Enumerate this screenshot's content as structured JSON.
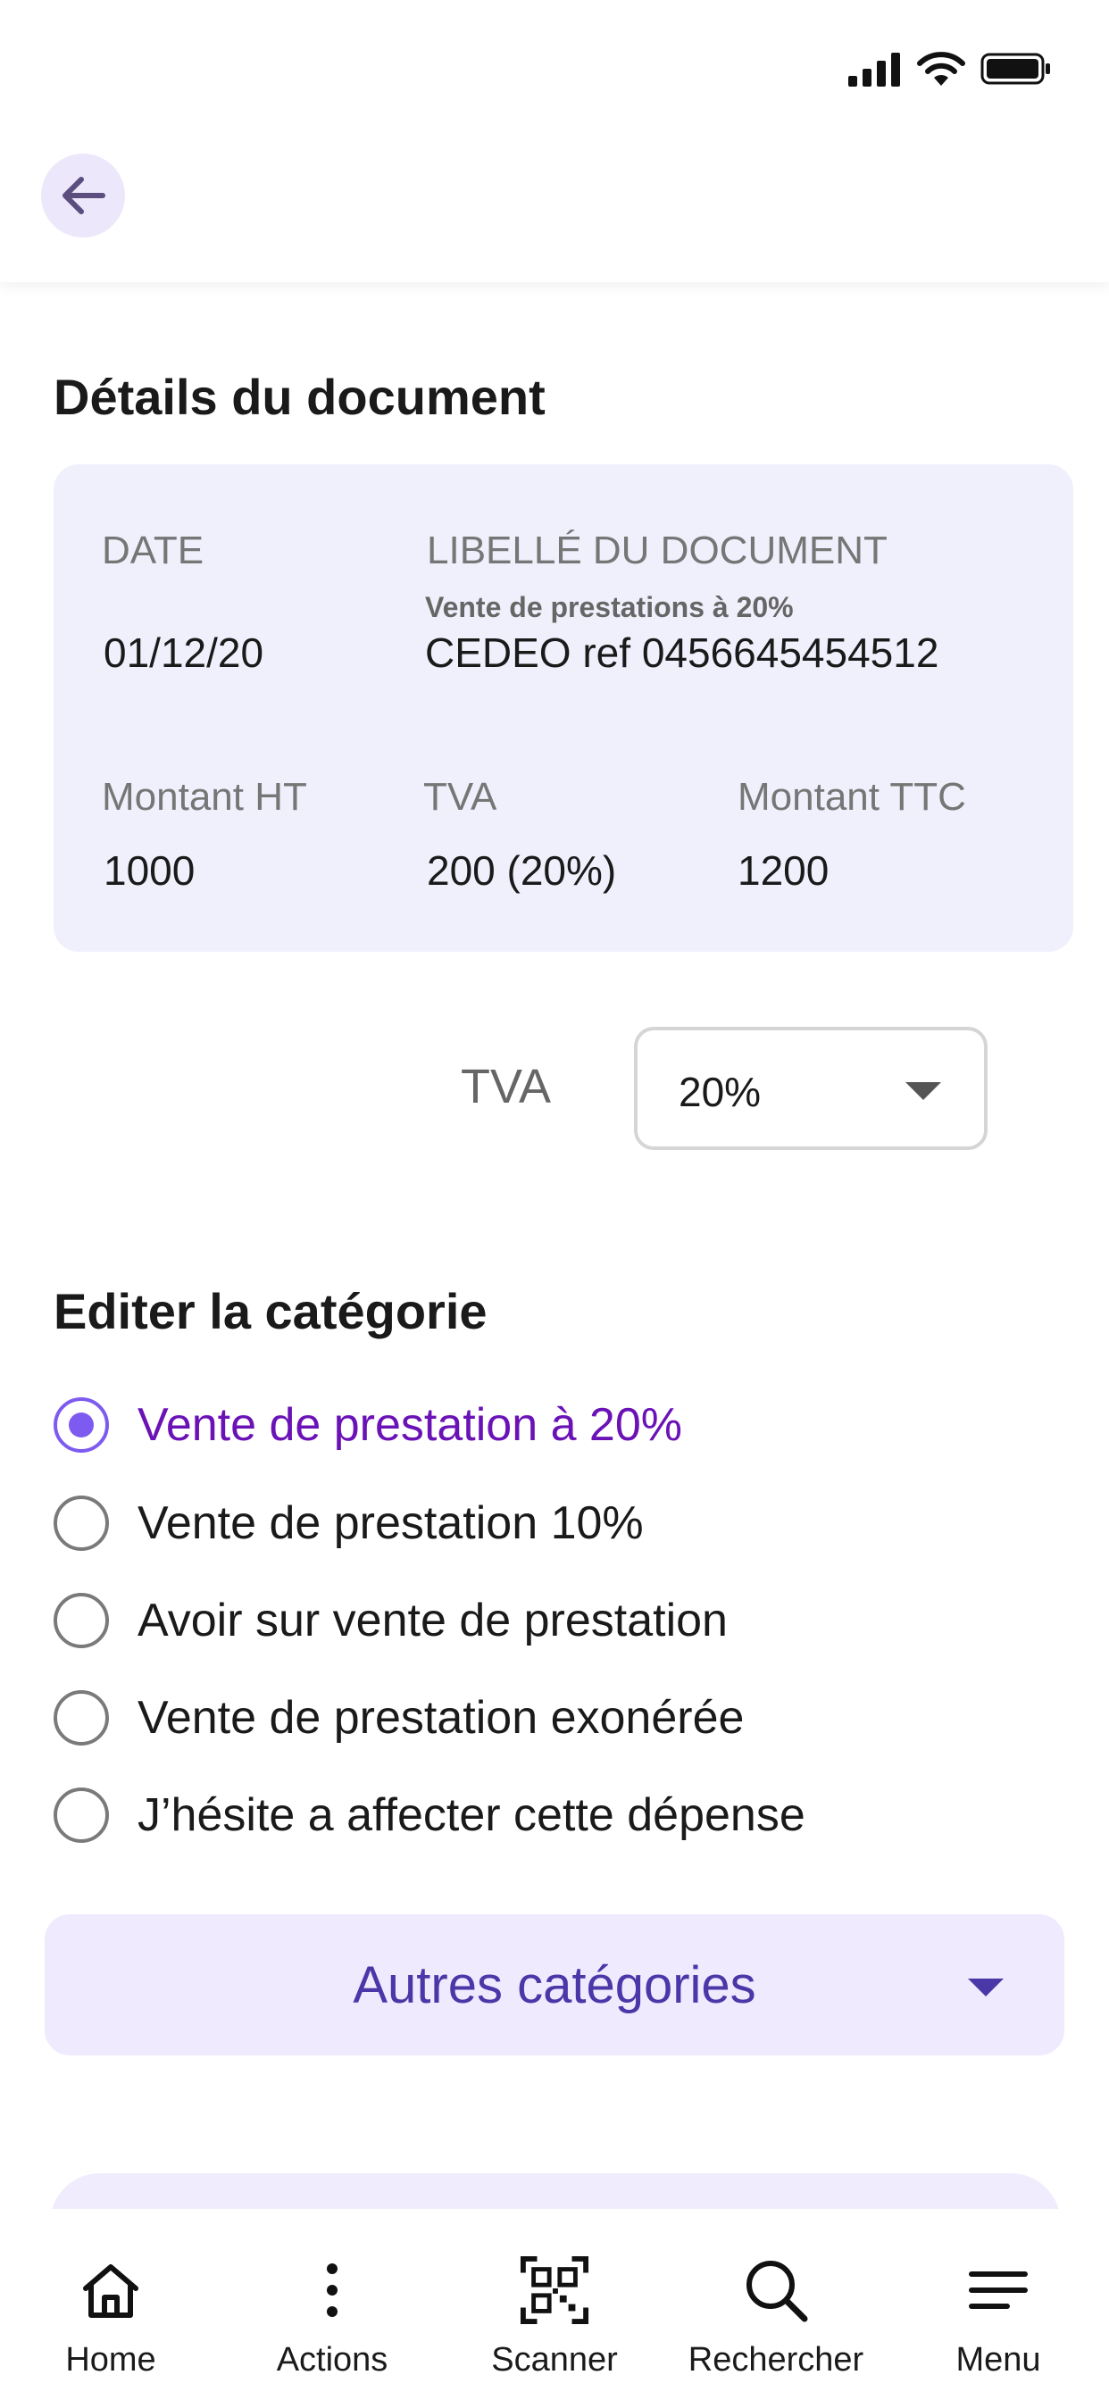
{
  "header": {
    "back_icon": "arrow-left-icon"
  },
  "details": {
    "title": "Détails du document",
    "date_label": "DATE",
    "date_value": "01/12/20",
    "libelle_label": "LIBELLÉ DU DOCUMENT",
    "libelle_sub": "Vente de prestations à 20%",
    "libelle_value": "CEDEO ref 0456645454512",
    "ht_label": "Montant HT",
    "ht_value": "1000",
    "tva_label": "TVA",
    "tva_value": "200 (20%)",
    "ttc_label": "Montant TTC",
    "ttc_value": "1200"
  },
  "tva_select": {
    "label": "TVA",
    "value": "20%"
  },
  "categorie": {
    "title": "Editer la catégorie",
    "options": [
      {
        "label": "Vente de prestation à 20%",
        "selected": true
      },
      {
        "label": "Vente de prestation 10%",
        "selected": false
      },
      {
        "label": "Avoir sur vente de prestation",
        "selected": false
      },
      {
        "label": "Vente de prestation exonérée",
        "selected": false
      },
      {
        "label": "J’hésite a affecter cette dépense",
        "selected": false
      }
    ]
  },
  "autres": {
    "label": "Autres catégories"
  },
  "nav": [
    {
      "label": "Home",
      "icon": "home-icon"
    },
    {
      "label": "Actions",
      "icon": "more-vertical-icon"
    },
    {
      "label": "Scanner",
      "icon": "qr-code-icon"
    },
    {
      "label": "Rechercher",
      "icon": "search-icon"
    },
    {
      "label": "Menu",
      "icon": "menu-icon"
    }
  ],
  "colors": {
    "accent": "#7d5af0",
    "accent_text": "#6b12b7",
    "card_bg": "#eff0fc",
    "autres_text": "#4a37a8"
  }
}
